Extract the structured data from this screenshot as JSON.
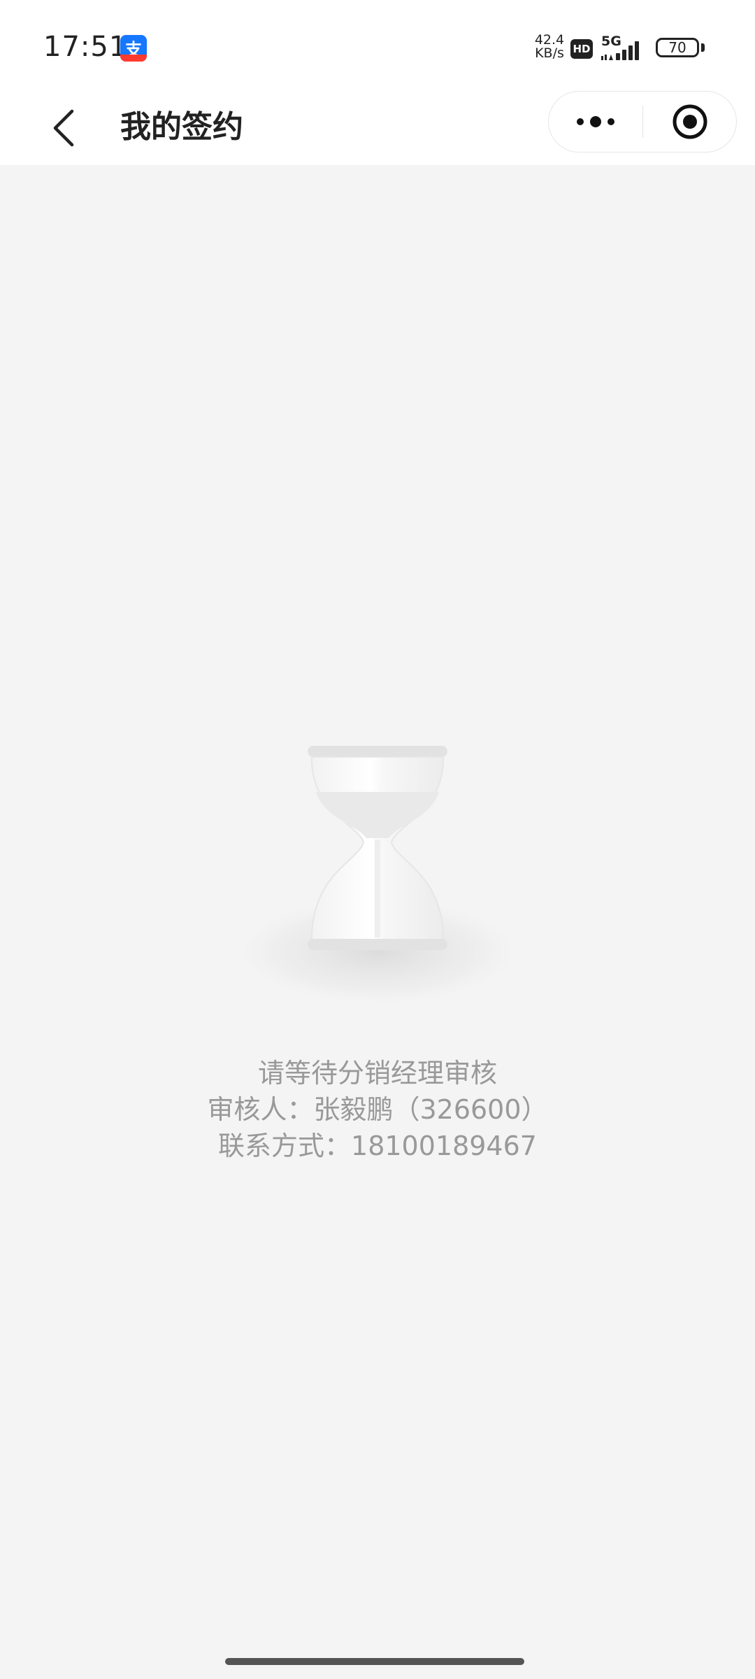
{
  "status_bar": {
    "time": "17:51",
    "app_badge_glyph": "支",
    "net_speed_value": "42.4",
    "net_speed_unit": "KB/s",
    "hd_label": "HD",
    "network_type": "5G",
    "battery_level": "70"
  },
  "header": {
    "title": "我的签约"
  },
  "content": {
    "line1": "请等待分销经理审核",
    "line2": "审核人：张毅鹏（326600）",
    "line3": "联系方式：18100189467"
  },
  "colors": {
    "background": "#f4f4f4",
    "header_bg": "#ffffff",
    "message_text": "#999999",
    "title_text": "#222222"
  },
  "icons": {
    "back": "chevron-left-icon",
    "more": "more-dots-icon",
    "close": "target-circle-icon",
    "illustration": "hourglass-icon"
  }
}
